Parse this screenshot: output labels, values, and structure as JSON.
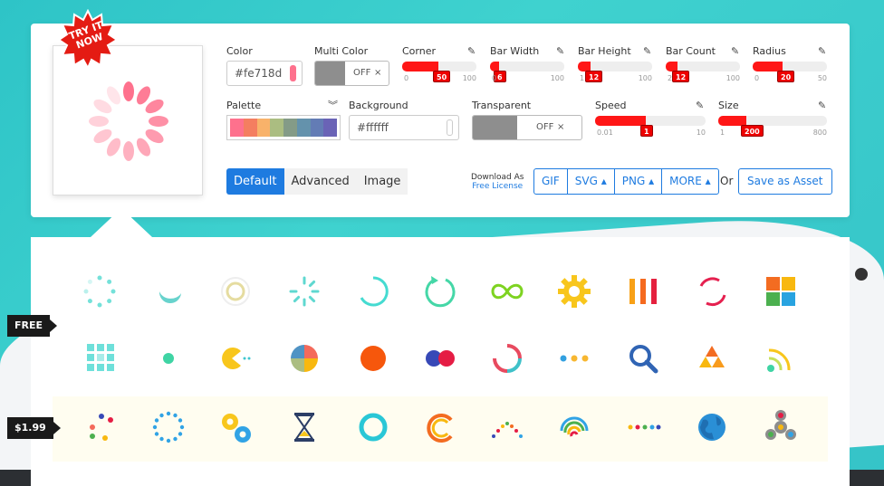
{
  "badge": {
    "line1": "TRY IT",
    "line2": "NOW"
  },
  "controls": {
    "color": {
      "label": "Color",
      "value": "#fe718d"
    },
    "multi_color": {
      "label": "Multi Color",
      "state": "OFF",
      "x": "×"
    },
    "corner": {
      "label": "Corner",
      "min": "0",
      "value": "50",
      "max": "100",
      "level": 0.5
    },
    "bar_width": {
      "label": "Bar Width",
      "min": "0",
      "value": "6",
      "max": "100",
      "level": 0.06
    },
    "bar_height": {
      "label": "Bar Height",
      "min": "1",
      "value": "12",
      "max": "100",
      "level": 0.12
    },
    "bar_count": {
      "label": "Bar Count",
      "min": "2",
      "value": "12",
      "max": "100",
      "level": 0.1
    },
    "radius": {
      "label": "Radius",
      "min": "0",
      "value": "20",
      "max": "50",
      "level": 0.4
    },
    "palette": {
      "label": "Palette",
      "colors": [
        "#fe718d",
        "#f47e60",
        "#f8b26a",
        "#abbd81",
        "#849b87",
        "#6492ac",
        "#637cb5",
        "#6a63b6"
      ]
    },
    "background": {
      "label": "Background",
      "value": "#ffffff"
    },
    "transparent": {
      "label": "Transparent",
      "state": "OFF",
      "x": "×"
    },
    "speed": {
      "label": "Speed",
      "min": "0.01",
      "value": "1",
      "max": "10",
      "level": 0.5
    },
    "size": {
      "label": "Size",
      "min": "1",
      "value": "200",
      "max": "800",
      "level": 0.25
    }
  },
  "tabs": [
    "Default",
    "Advanced",
    "Image"
  ],
  "download": {
    "label": "Download As",
    "license": "Free License",
    "buttons": [
      "GIF",
      "SVG",
      "PNG",
      "MORE"
    ],
    "or": "Or",
    "save": "Save as Asset"
  },
  "gallery": {
    "free_tag": "FREE",
    "paid_tag": "$1.99"
  }
}
